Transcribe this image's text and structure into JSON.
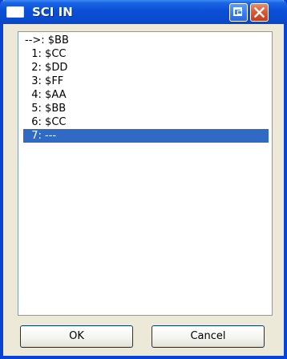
{
  "window": {
    "title": "SCI IN"
  },
  "titlebar": {
    "app_icon": "window-icon",
    "restore_icon": "restore-icon",
    "close_icon": "close-icon"
  },
  "listbox": {
    "items": [
      "-->: $BB",
      "  1: $CC",
      "  2: $DD",
      "  3: $FF",
      "  4: $AA",
      "  5: $BB",
      "  6: $CC",
      "  7: ---"
    ],
    "selected_index": 7
  },
  "buttons": {
    "ok_label": "OK",
    "cancel_label": "Cancel"
  },
  "colors": {
    "titlebar": "#0a4fd6",
    "selection": "#316ac5",
    "face": "#ece9d8",
    "close": "#da5a3a"
  }
}
